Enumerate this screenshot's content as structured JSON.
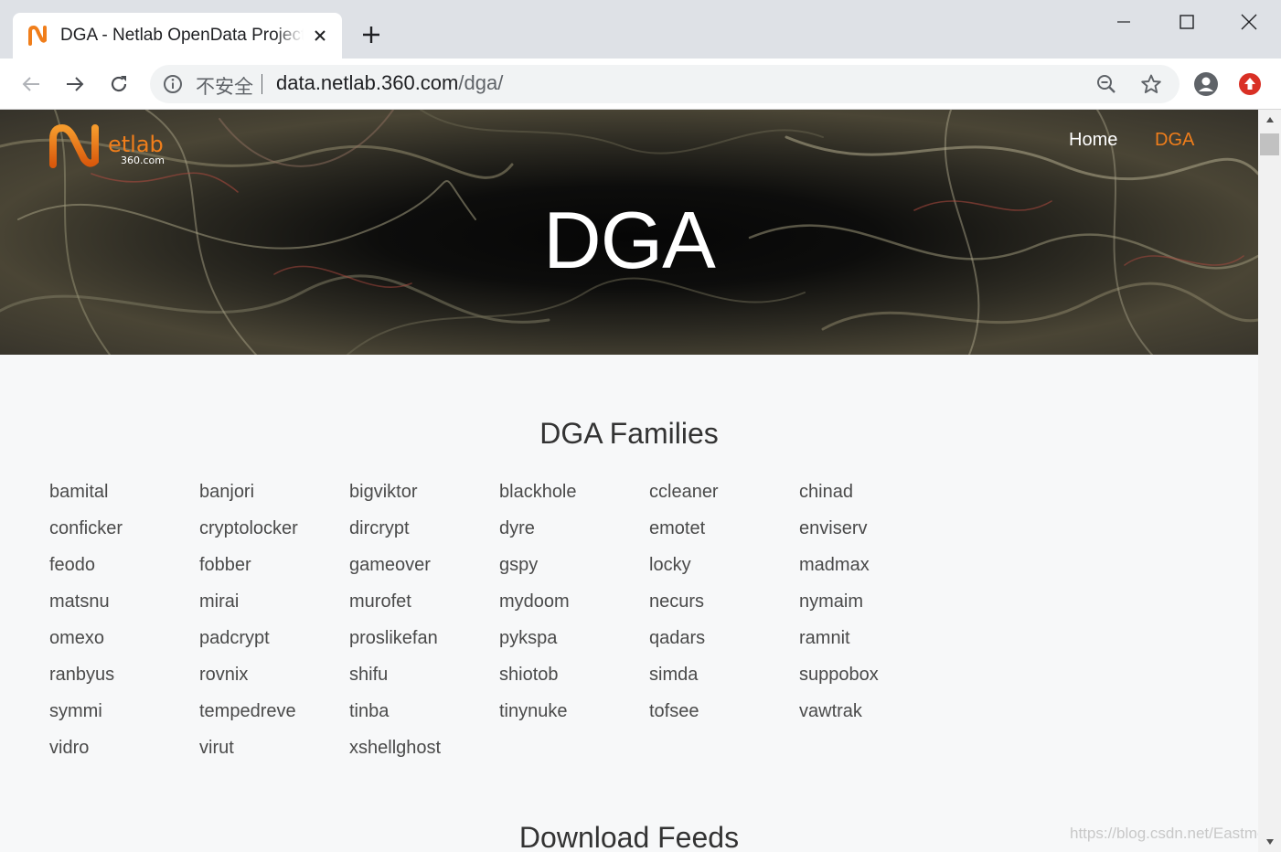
{
  "browser": {
    "tab_title": "DGA - Netlab OpenData Project",
    "security_label": "不安全",
    "url_host": "data.netlab.360.com",
    "url_path": "/dga/"
  },
  "site": {
    "logo_text": "etlab",
    "logo_subtext": "360.com",
    "nav": {
      "home": "Home",
      "dga": "DGA"
    },
    "hero_title": "DGA",
    "accent_color": "#f07e1b"
  },
  "families_section": {
    "title": "DGA Families",
    "items": [
      "bamital",
      "banjori",
      "bigviktor",
      "blackhole",
      "ccleaner",
      "chinad",
      "conficker",
      "cryptolocker",
      "dircrypt",
      "dyre",
      "emotet",
      "enviserv",
      "feodo",
      "fobber",
      "gameover",
      "gspy",
      "locky",
      "madmax",
      "matsnu",
      "mirai",
      "murofet",
      "mydoom",
      "necurs",
      "nymaim",
      "omexo",
      "padcrypt",
      "proslikefan",
      "pykspa",
      "qadars",
      "ramnit",
      "ranbyus",
      "rovnix",
      "shifu",
      "shiotob",
      "simda",
      "suppobox",
      "symmi",
      "tempedreve",
      "tinba",
      "tinynuke",
      "tofsee",
      "vawtrak",
      "vidro",
      "virut",
      "xshellghost"
    ]
  },
  "download_section": {
    "title": "Download Feeds"
  },
  "watermark": "https://blog.csdn.net/Eastmount"
}
